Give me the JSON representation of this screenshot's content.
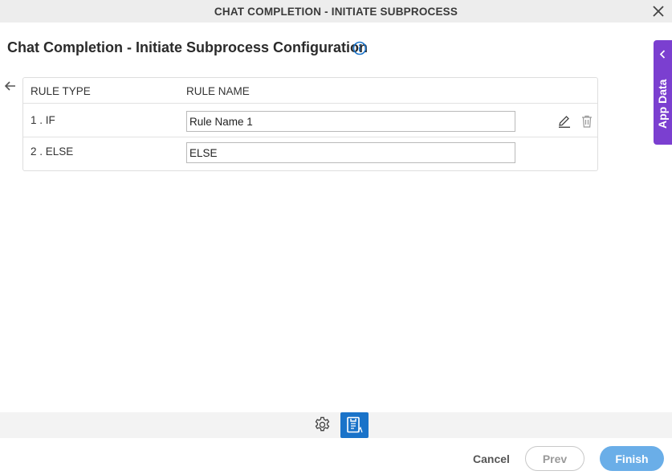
{
  "window": {
    "title": "CHAT COMPLETION - INITIATE SUBPROCESS"
  },
  "page": {
    "title": "Chat Completion - Initiate Subprocess Configuration"
  },
  "table": {
    "headers": {
      "rule_type": "RULE TYPE",
      "rule_name": "RULE NAME"
    },
    "rows": [
      {
        "rule_type": "1 . IF",
        "rule_name": "Rule Name 1"
      },
      {
        "rule_type": "2 . ELSE",
        "rule_name": "ELSE"
      }
    ]
  },
  "side_panel": {
    "label": "App Data"
  },
  "footer": {
    "cancel_label": "Cancel",
    "prev_label": "Prev",
    "finish_label": "Finish"
  },
  "colors": {
    "accent": "#7b3fd0",
    "primary": "#1a73c9",
    "finish": "#6aaee8",
    "info": "#1a73c9"
  },
  "icons": [
    "close-icon",
    "info-icon",
    "back-arrow-icon",
    "edit-icon",
    "delete-icon",
    "chevron-left-icon",
    "settings-icon",
    "document-icon"
  ]
}
